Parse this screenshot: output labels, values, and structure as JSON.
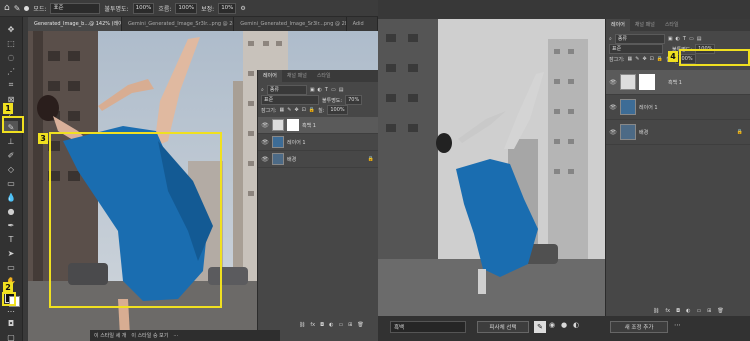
{
  "left_window": {
    "options_bar": {
      "flow_label": "흐름:",
      "mode_label": "모드:",
      "mode_value": "표준",
      "opacity_label": "불투명도:",
      "opacity_value": "100%",
      "flow_value": "100%",
      "smoothing_label": "보정:",
      "smoothing_value": "10%"
    },
    "tabs": [
      {
        "label": "Generated_Image_b...@ 142% (레이어...",
        "active": true
      },
      {
        "label": "Gemini_Generated_Image_Sr3lr...png @ 285% (레이어...",
        "active": false
      },
      {
        "label": "Gemini_Generated_Image_Sr3lr...png @ 285% (레이어...",
        "active": false
      },
      {
        "label": "Adid",
        "active": false
      }
    ],
    "layers_panel": {
      "tabs": [
        "레이어",
        "채널 패널",
        "스타일"
      ],
      "kind_filter": "종류",
      "blend_mode": "표준",
      "opacity_label": "불투명도:",
      "opacity_value": "70%",
      "lock_label": "잠그기:",
      "fill_label": "칠:",
      "fill_value": "100%",
      "layers": [
        {
          "name": "흑백 1",
          "selected": true
        },
        {
          "name": "레이어 1",
          "selected": false
        },
        {
          "name": "배경",
          "selected": false
        }
      ]
    },
    "context_bar": {
      "left": "이 스타일 세 개",
      "right": "이 스타일 승 보기"
    },
    "annotations": [
      "1",
      "2",
      "3"
    ]
  },
  "right_window": {
    "layers_panel": {
      "tabs": [
        "레이어",
        "채널 패널",
        "스타일"
      ],
      "kind_filter": "종류",
      "blend_mode": "표준",
      "opacity_label": "불투명도:",
      "opacity_value": "100%",
      "lock_label": "잠그기:",
      "fill_label": "칠:",
      "fill_value": "100%",
      "layers": [
        {
          "name": "흑백 1",
          "selected": true
        },
        {
          "name": "레이어 1",
          "selected": false
        },
        {
          "name": "배경",
          "selected": false
        }
      ]
    },
    "bottom_bar": {
      "mode": "흑백",
      "select_subject": "피사체 선택",
      "new_adjust": "새 조정 추가"
    },
    "annotation": "4"
  },
  "colors": {
    "highlight": "#f0e020",
    "dress": "#1a6db0",
    "panel_bg": "#474747",
    "app_bg": "#323232"
  }
}
